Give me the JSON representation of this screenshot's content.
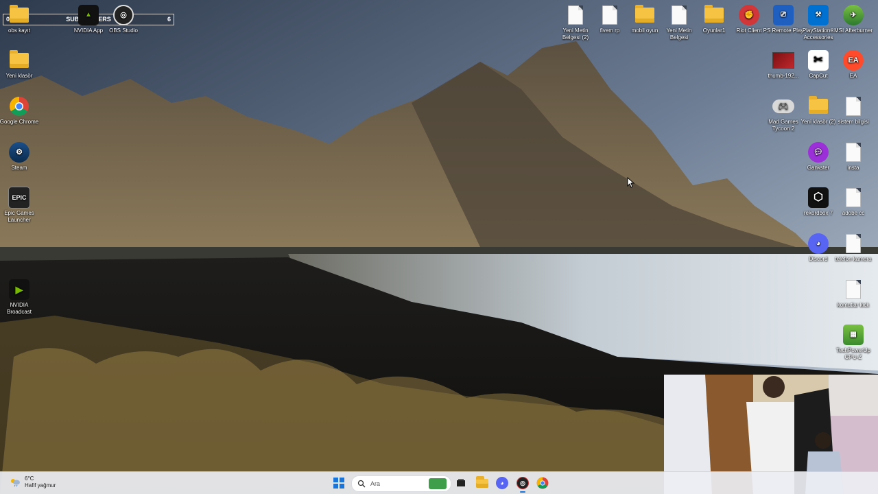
{
  "overlay": {
    "subscribers_label": "SUBSCRIBERS",
    "start_count": "0",
    "goal_count": "6"
  },
  "desktop_left": [
    {
      "label": "obs kayıt",
      "icon": "folder-icon"
    },
    {
      "label": "NVIDIA App",
      "icon": "nvidia-icon"
    },
    {
      "label": "OBS Studio",
      "icon": "obs-icon"
    },
    {
      "label": "Yeni klasör",
      "icon": "folder-icon"
    },
    {
      "label": "Google Chrome",
      "icon": "chrome-icon"
    },
    {
      "label": "Steam",
      "icon": "steam-icon"
    },
    {
      "label": "Epic Games Launcher",
      "icon": "epic-icon"
    },
    {
      "label": "NVIDIA Broadcast",
      "icon": "nvidia-broadcast-icon"
    }
  ],
  "desktop_right": [
    {
      "label": "Yeni Metin Belgesi (2)",
      "icon": "text-file-icon"
    },
    {
      "label": "fivem rp",
      "icon": "text-file-icon"
    },
    {
      "label": "mobil oyun",
      "icon": "folder-icon"
    },
    {
      "label": "Yeni Metin Belgesi",
      "icon": "text-file-icon"
    },
    {
      "label": "Oyunlar1",
      "icon": "folder-icon"
    },
    {
      "label": "Riot Client",
      "icon": "riot-icon"
    },
    {
      "label": "PS Remote Play",
      "icon": "ps-remote-icon"
    },
    {
      "label": "PlayStation® Accessories",
      "icon": "playstation-icon"
    },
    {
      "label": "MSI Afterburner",
      "icon": "msi-icon"
    },
    {
      "label": "thumb-192...",
      "icon": "image-file-icon"
    },
    {
      "label": "CapCut",
      "icon": "capcut-icon"
    },
    {
      "label": "EA",
      "icon": "ea-icon"
    },
    {
      "label": "Mad Games Tycoon 2",
      "icon": "gamepad-icon"
    },
    {
      "label": "Yeni klasör (2)",
      "icon": "folder-icon"
    },
    {
      "label": "sistem bilgisi",
      "icon": "text-file-icon"
    },
    {
      "label": "Gankster",
      "icon": "gankster-icon"
    },
    {
      "label": "insta",
      "icon": "text-file-icon"
    },
    {
      "label": "rekordbox 7",
      "icon": "rekordbox-icon"
    },
    {
      "label": "adobe cc",
      "icon": "text-file-icon"
    },
    {
      "label": "Discord",
      "icon": "discord-icon"
    },
    {
      "label": "telefon kamera",
      "icon": "text-file-icon"
    },
    {
      "label": "komutlar kick",
      "icon": "text-file-icon"
    },
    {
      "label": "TechPowerUp GPU-Z",
      "icon": "gpuz-icon"
    }
  ],
  "taskbar": {
    "weather_temp": "6°C",
    "weather_desc": "Hafif yağmur",
    "search_placeholder": "Ara"
  },
  "colors": {
    "accent": "#1b74d8",
    "taskbar": "#eceef3"
  }
}
